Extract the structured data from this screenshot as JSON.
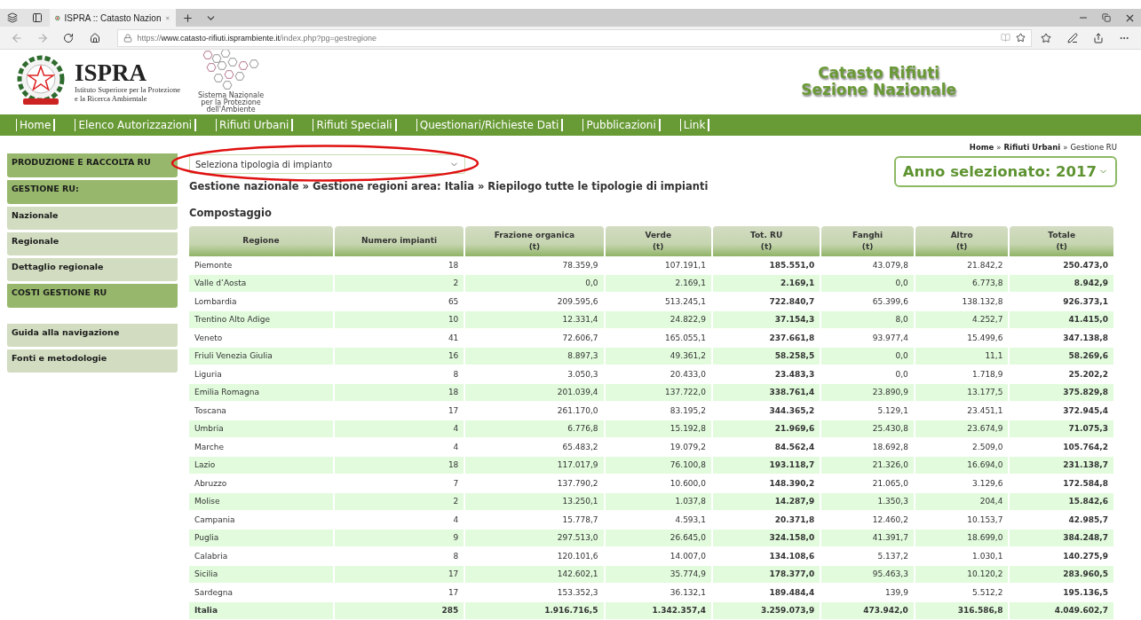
{
  "browser": {
    "tab_title": "ISPRA :: Catasto Nazion",
    "url_prefix": "https://",
    "url_host": "www.catasto-rifiuti.isprambiente.it",
    "url_path": "/index.php?pg=gestregione"
  },
  "header": {
    "logo_title": "ISPRA",
    "logo_subtitle": [
      "Istituto Superiore per la Protezione",
      "e la Ricerca Ambientale"
    ],
    "snpa_lines": [
      "Sistema Nazionale",
      "per la Protezione",
      "dell'Ambiente"
    ],
    "site_title": [
      "Catasto Rifiuti",
      "Sezione Nazionale"
    ]
  },
  "nav": [
    "Home",
    "Elenco Autorizzazioni",
    "Rifiuti Urbani",
    "Rifiuti Speciali",
    "Questionari/Richieste Dati",
    "Pubblicazioni",
    "Link"
  ],
  "sidebar": {
    "menu": [
      {
        "label": "PRODUZIONE E RACCOLTA RU",
        "kind": "section"
      },
      {
        "label": "GESTIONE RU:",
        "kind": "section"
      },
      {
        "label": "Nazionale",
        "kind": "link"
      },
      {
        "label": "Regionale",
        "kind": "link"
      },
      {
        "label": "Dettaglio regionale",
        "kind": "link"
      },
      {
        "label": "COSTI GESTIONE RU",
        "kind": "section"
      }
    ],
    "help": [
      {
        "label": "Guida alla navigazione",
        "kind": "link"
      },
      {
        "label": "Fonti e metodologie",
        "kind": "link"
      }
    ]
  },
  "select": {
    "placeholder": "Seleziona tipologia di impianto"
  },
  "crumbs": [
    {
      "label": "Home",
      "kind": "link"
    },
    {
      "label": "»",
      "kind": "separator"
    },
    {
      "label": "Rifiuti Urbani",
      "kind": "link"
    },
    {
      "label": "»",
      "kind": "separator"
    },
    {
      "label": "Gestione RU",
      "kind": "current"
    }
  ],
  "year": {
    "label": "Anno selezionato: 2017"
  },
  "title_path": "Gestione nazionale » Gestione regioni area: Italia » Riepilogo tutte le tipologie di impianti",
  "section": "Compostaggio",
  "table": {
    "columns": [
      {
        "label": "Regione",
        "bold": false
      },
      {
        "label": "Numero impianti",
        "bold": false
      },
      {
        "label": "Frazione organica",
        "unit": "(t)",
        "bold": false
      },
      {
        "label": "Verde",
        "unit": "(t)",
        "bold": false
      },
      {
        "label": "Tot. RU",
        "unit": "(t)",
        "bold": true
      },
      {
        "label": "Fanghi",
        "unit": "(t)",
        "bold": false
      },
      {
        "label": "Altro",
        "unit": "(t)",
        "bold": false
      },
      {
        "label": "Totale",
        "unit": "(t)",
        "bold": true
      }
    ],
    "rows": [
      {
        "kind": "region",
        "cells": [
          "Piemonte",
          "18",
          "78.359,9",
          "107.191,1",
          "185.551,0",
          "43.079,8",
          "21.842,2",
          "250.473,0"
        ]
      },
      {
        "kind": "region",
        "cells": [
          "Valle d’Aosta",
          "2",
          "0,0",
          "2.169,1",
          "2.169,1",
          "0,0",
          "6.773,8",
          "8.942,9"
        ]
      },
      {
        "kind": "region",
        "cells": [
          "Lombardia",
          "65",
          "209.595,6",
          "513.245,1",
          "722.840,7",
          "65.399,6",
          "138.132,8",
          "926.373,1"
        ]
      },
      {
        "kind": "region",
        "cells": [
          "Trentino Alto Adige",
          "10",
          "12.331,4",
          "24.822,9",
          "37.154,3",
          "8,0",
          "4.252,7",
          "41.415,0"
        ]
      },
      {
        "kind": "region",
        "cells": [
          "Veneto",
          "41",
          "72.606,7",
          "165.055,1",
          "237.661,8",
          "93.977,4",
          "15.499,6",
          "347.138,8"
        ]
      },
      {
        "kind": "region",
        "cells": [
          "Friuli Venezia Giulia",
          "16",
          "8.897,3",
          "49.361,2",
          "58.258,5",
          "0,0",
          "11,1",
          "58.269,6"
        ]
      },
      {
        "kind": "region",
        "cells": [
          "Liguria",
          "8",
          "3.050,3",
          "20.433,0",
          "23.483,3",
          "0,0",
          "1.718,9",
          "25.202,2"
        ]
      },
      {
        "kind": "region",
        "cells": [
          "Emilia Romagna",
          "18",
          "201.039,4",
          "137.722,0",
          "338.761,4",
          "23.890,9",
          "13.177,5",
          "375.829,8"
        ]
      },
      {
        "kind": "region",
        "cells": [
          "Toscana",
          "17",
          "261.170,0",
          "83.195,2",
          "344.365,2",
          "5.129,1",
          "23.451,1",
          "372.945,4"
        ]
      },
      {
        "kind": "region",
        "cells": [
          "Umbria",
          "4",
          "6.776,8",
          "15.192,8",
          "21.969,6",
          "25.430,8",
          "23.674,9",
          "71.075,3"
        ]
      },
      {
        "kind": "region",
        "cells": [
          "Marche",
          "4",
          "65.483,2",
          "19.079,2",
          "84.562,4",
          "18.692,8",
          "2.509,0",
          "105.764,2"
        ]
      },
      {
        "kind": "region",
        "cells": [
          "Lazio",
          "18",
          "117.017,9",
          "76.100,8",
          "193.118,7",
          "21.326,0",
          "16.694,0",
          "231.138,7"
        ]
      },
      {
        "kind": "region",
        "cells": [
          "Abruzzo",
          "7",
          "137.790,2",
          "10.600,0",
          "148.390,2",
          "21.065,0",
          "3.129,6",
          "172.584,8"
        ]
      },
      {
        "kind": "region",
        "cells": [
          "Molise",
          "2",
          "13.250,1",
          "1.037,8",
          "14.287,9",
          "1.350,3",
          "204,4",
          "15.842,6"
        ]
      },
      {
        "kind": "region",
        "cells": [
          "Campania",
          "4",
          "15.778,7",
          "4.593,1",
          "20.371,8",
          "12.460,2",
          "10.153,7",
          "42.985,7"
        ]
      },
      {
        "kind": "region",
        "cells": [
          "Puglia",
          "9",
          "297.513,0",
          "26.645,0",
          "324.158,0",
          "41.391,7",
          "18.699,0",
          "384.248,7"
        ]
      },
      {
        "kind": "region",
        "cells": [
          "Calabria",
          "8",
          "120.101,6",
          "14.007,0",
          "134.108,6",
          "5.137,2",
          "1.030,1",
          "140.275,9"
        ]
      },
      {
        "kind": "region",
        "cells": [
          "Sicilia",
          "17",
          "142.602,1",
          "35.774,9",
          "178.377,0",
          "95.463,3",
          "10.120,2",
          "283.960,5"
        ]
      },
      {
        "kind": "region",
        "cells": [
          "Sardegna",
          "17",
          "153.352,3",
          "36.132,1",
          "189.484,4",
          "139,9",
          "5.512,2",
          "195.136,5"
        ]
      },
      {
        "kind": "total",
        "cells": [
          "Italia",
          "285",
          "1.916.716,5",
          "1.342.357,4",
          "3.259.073,9",
          "473.942,0",
          "316.586,8",
          "4.049.602,7"
        ]
      }
    ]
  }
}
